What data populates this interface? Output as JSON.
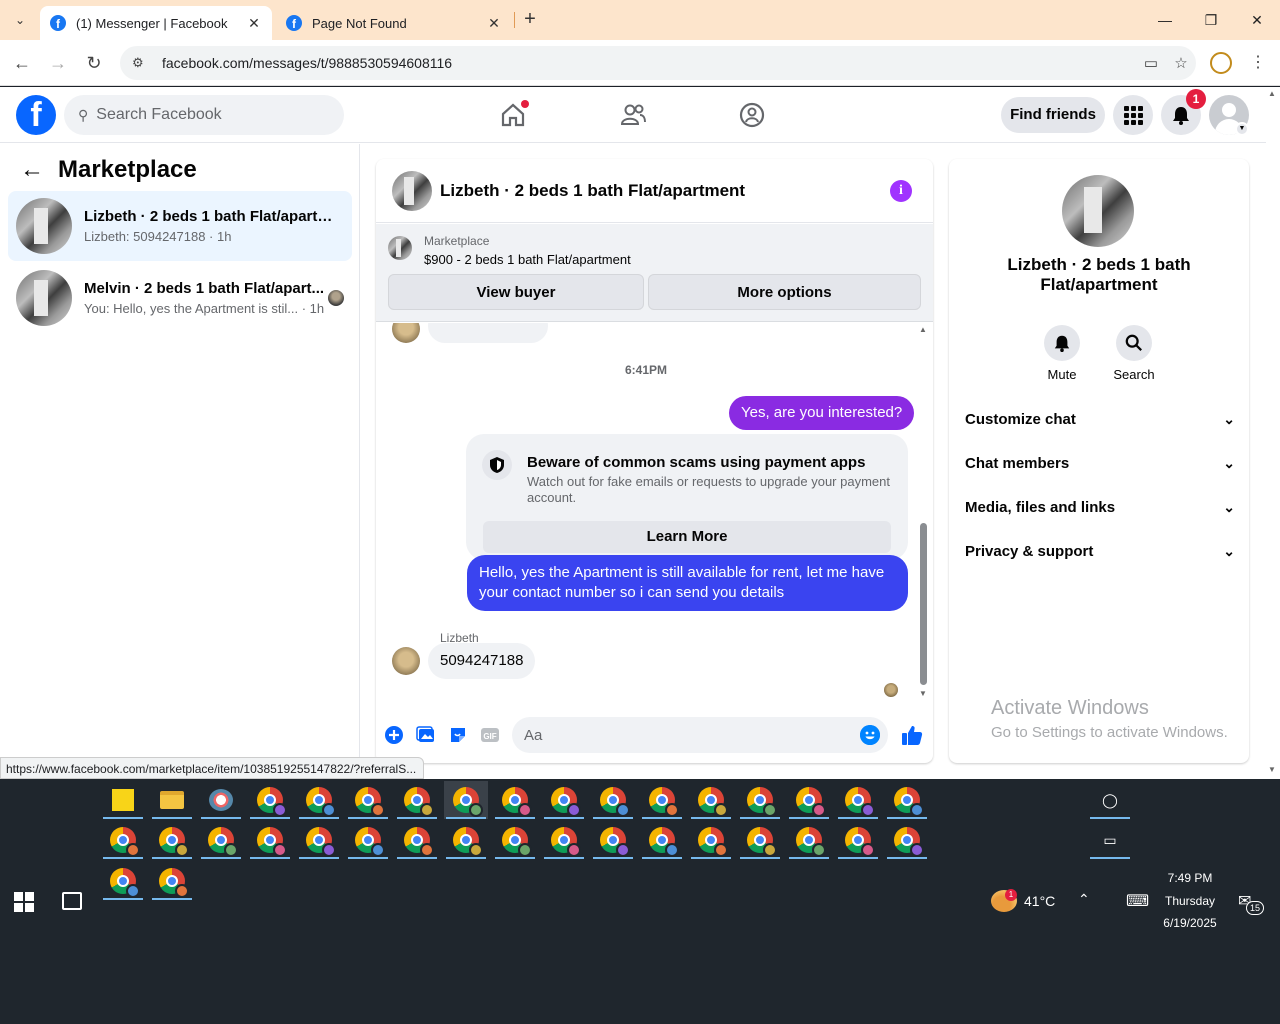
{
  "browser": {
    "tabs": [
      {
        "title": "(1) Messenger | Facebook",
        "active": true
      },
      {
        "title": "Page Not Found",
        "active": false
      }
    ],
    "url": "facebook.com/messages/t/9888530594608116",
    "status_url": "https://www.facebook.com/marketplace/item/1038519255147822/?referralS..."
  },
  "facebook": {
    "search_placeholder": "Search Facebook",
    "find_friends": "Find friends",
    "notification_count": "1"
  },
  "sidebar": {
    "title": "Marketplace",
    "conversations": [
      {
        "name": "Lizbeth · 2 beds 1 bath Flat/apartm...",
        "preview": "Lizbeth: 5094247188 · 1h",
        "selected": true
      },
      {
        "name": "Melvin · 2 beds 1 bath Flat/apart...",
        "preview": "You: Hello, yes the Apartment is stil... · 1h",
        "selected": false
      }
    ]
  },
  "chat": {
    "title": "Lizbeth · 2 beds 1 bath Flat/apartment",
    "listing_label": "Marketplace",
    "listing_title": "$900 - 2 beds 1 bath Flat/apartment",
    "view_buyer": "View buyer",
    "more_options": "More options",
    "timestamp": "6:41PM",
    "messages": [
      {
        "from": "me",
        "text": "Yes, are you interested?"
      },
      {
        "from": "me",
        "text": "Hello, yes the Apartment is still available for rent, let me have your contact number so i can send you details"
      },
      {
        "from": "Lizbeth",
        "text": "5094247188"
      }
    ],
    "scam_card": {
      "title": "Beware of common scams using payment apps",
      "body": "Watch out for fake emails or requests to upgrade your payment account.",
      "button": "Learn More"
    },
    "sender_label": "Lizbeth",
    "composer_placeholder": "Aa"
  },
  "details": {
    "title": "Lizbeth · 2 beds 1 bath Flat/apartment",
    "actions": [
      "Mute",
      "Search"
    ],
    "sections": [
      "Customize chat",
      "Chat members",
      "Media, files and links",
      "Privacy & support"
    ]
  },
  "watermark": {
    "line1": "Activate Windows",
    "line2": "Go to Settings to activate Windows."
  },
  "taskbar": {
    "temperature": "41°C",
    "weather_badge": "1",
    "time": "7:49 PM",
    "day": "Thursday",
    "date": "6/19/2025",
    "notifications": "15"
  },
  "colors": {
    "fb_blue": "#0866ff",
    "messenger_purple": "#8a2be2",
    "messenger_blue": "#3a44f0",
    "tab_bar": "#fde5cc"
  }
}
